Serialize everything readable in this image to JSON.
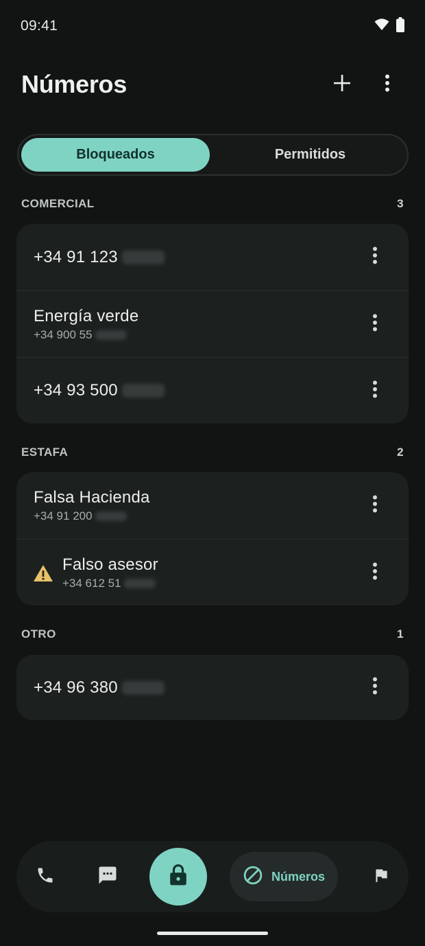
{
  "status_bar": {
    "time": "09:41",
    "icons": [
      "wifi-icon",
      "battery-icon"
    ]
  },
  "app_bar": {
    "title": "Números",
    "actions": [
      "add-icon",
      "more-vert-icon"
    ]
  },
  "tabs": [
    {
      "label": "Bloqueados",
      "selected": true
    },
    {
      "label": "Permitidos",
      "selected": false
    }
  ],
  "sections": [
    {
      "title": "COMERCIAL",
      "count": "3",
      "rows": [
        {
          "main": "+34 91 123",
          "sub": ""
        },
        {
          "main": "Energía verde",
          "sub": "+34 900 55"
        },
        {
          "main": "+34 93 500",
          "sub": ""
        }
      ]
    },
    {
      "title": "ESTAFA",
      "count": "2",
      "rows": [
        {
          "main": "Falsa Hacienda",
          "sub": "+34 91 200"
        },
        {
          "main": "Falso asesor",
          "sub": "+34 612 51",
          "icon": "warning-icon"
        }
      ]
    },
    {
      "title": "OTRO",
      "count": "1",
      "rows": [
        {
          "main": "+34 96 380",
          "sub": ""
        }
      ]
    }
  ],
  "bottom_nav": {
    "items": [
      "phone-icon",
      "message-icon",
      "lock-icon",
      "block-icon",
      "flag-icon"
    ],
    "active_label": "Números"
  },
  "colors": {
    "background": "#121414",
    "accent": "#7fd3c3",
    "card": "#1c2120",
    "warning": "#e8c26a"
  }
}
